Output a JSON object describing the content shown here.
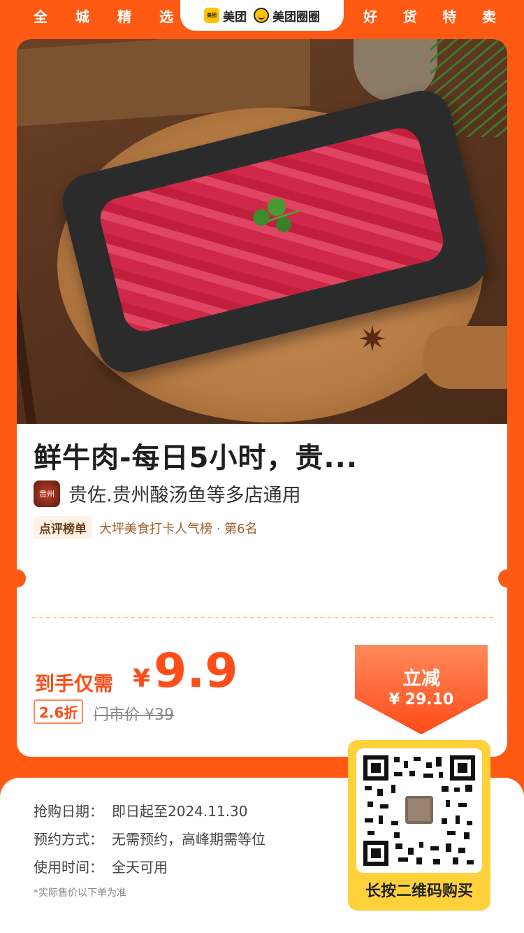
{
  "header": {
    "left_chars": [
      "全",
      "城",
      "精",
      "选"
    ],
    "right_chars": [
      "好",
      "货",
      "特",
      "卖"
    ],
    "brand1": "美团",
    "brand1_logo": "美团",
    "brand2": "美团圈圈"
  },
  "product": {
    "title": "鲜牛肉-每日5小时，贵...",
    "shop_avatar_text": "贵州",
    "shop_name": "贵佐.贵州酸汤鱼等多店通用",
    "rank_badge": "点评榜单",
    "rank_text": "大坪美食打卡人气榜 · 第6名"
  },
  "price": {
    "label": "到手仅需",
    "currency": "¥",
    "value": "9.9",
    "discount": "2.6折",
    "original": "门市价 ¥39"
  },
  "reduce": {
    "title": "立减",
    "value": "¥ 29.10"
  },
  "info": [
    {
      "key": "抢购日期：",
      "value": "即日起至2024.11.30"
    },
    {
      "key": "预约方式：",
      "value": "无需预约，高峰期需等位"
    },
    {
      "key": "使用时间：",
      "value": "全天可用"
    }
  ],
  "note": "*实际售价以下单为准",
  "qr": {
    "label": "长按二维码购买"
  },
  "colors": {
    "brand_orange": "#ff5a14",
    "price_red": "#ff4d1a",
    "qr_yellow": "#ffd23c"
  }
}
